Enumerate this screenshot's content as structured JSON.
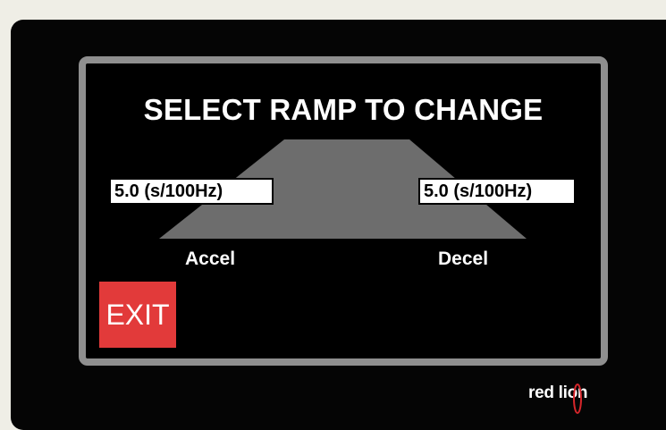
{
  "screen": {
    "title": "SELECT RAMP TO CHANGE",
    "accel": {
      "value": "5.0 (s/100Hz)",
      "label": "Accel"
    },
    "decel": {
      "value": "5.0 (s/100Hz)",
      "label": "Decel"
    },
    "exit_label": "EXIT"
  },
  "brand": {
    "logo_text": "red lion"
  },
  "colors": {
    "screen_bg": "#000000",
    "bezel": "#8f8f8f",
    "ramp": "#6d6d6d",
    "exit_button": "#e23a3a",
    "logo_accent": "#d6262b"
  },
  "icons": {
    "ramp_graphic": "trapezoid-ramp-icon"
  }
}
